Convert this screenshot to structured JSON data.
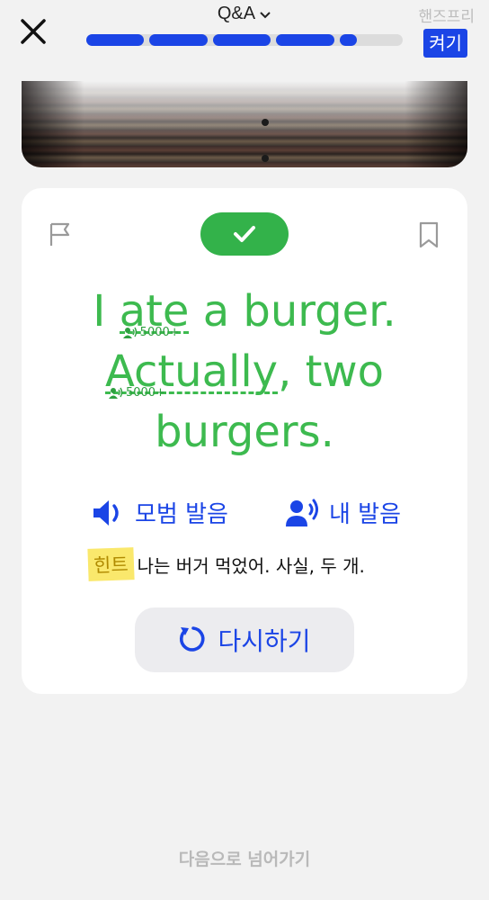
{
  "header": {
    "title": "Q&A",
    "handsfree_label": "핸즈프리",
    "toggle_label": "켜기",
    "progress": {
      "segments_total": 5,
      "segments_completed": 4,
      "current_fraction": 0.3
    }
  },
  "card": {
    "sentence_parts": {
      "p1": "I ",
      "w1": "ate",
      "p2": " a burger.",
      "w2": "Actually",
      "p3": ", two",
      "p4": "burgers."
    },
    "word_counts": {
      "w1": "5000+",
      "w2": "5000+"
    },
    "model_pronunciation_label": "모범 발음",
    "my_pronunciation_label": "내 발음",
    "hint_tag": "힌트",
    "hint_text": "나는 버거 먹었어. 사실, 두 개.",
    "retry_label": "다시하기"
  },
  "footer": {
    "next_label": "다음으로 넘어가기"
  },
  "colors": {
    "accent_blue": "#1b45e6",
    "success_green": "#3dba4f",
    "hint_yellow": "#fae86c"
  }
}
